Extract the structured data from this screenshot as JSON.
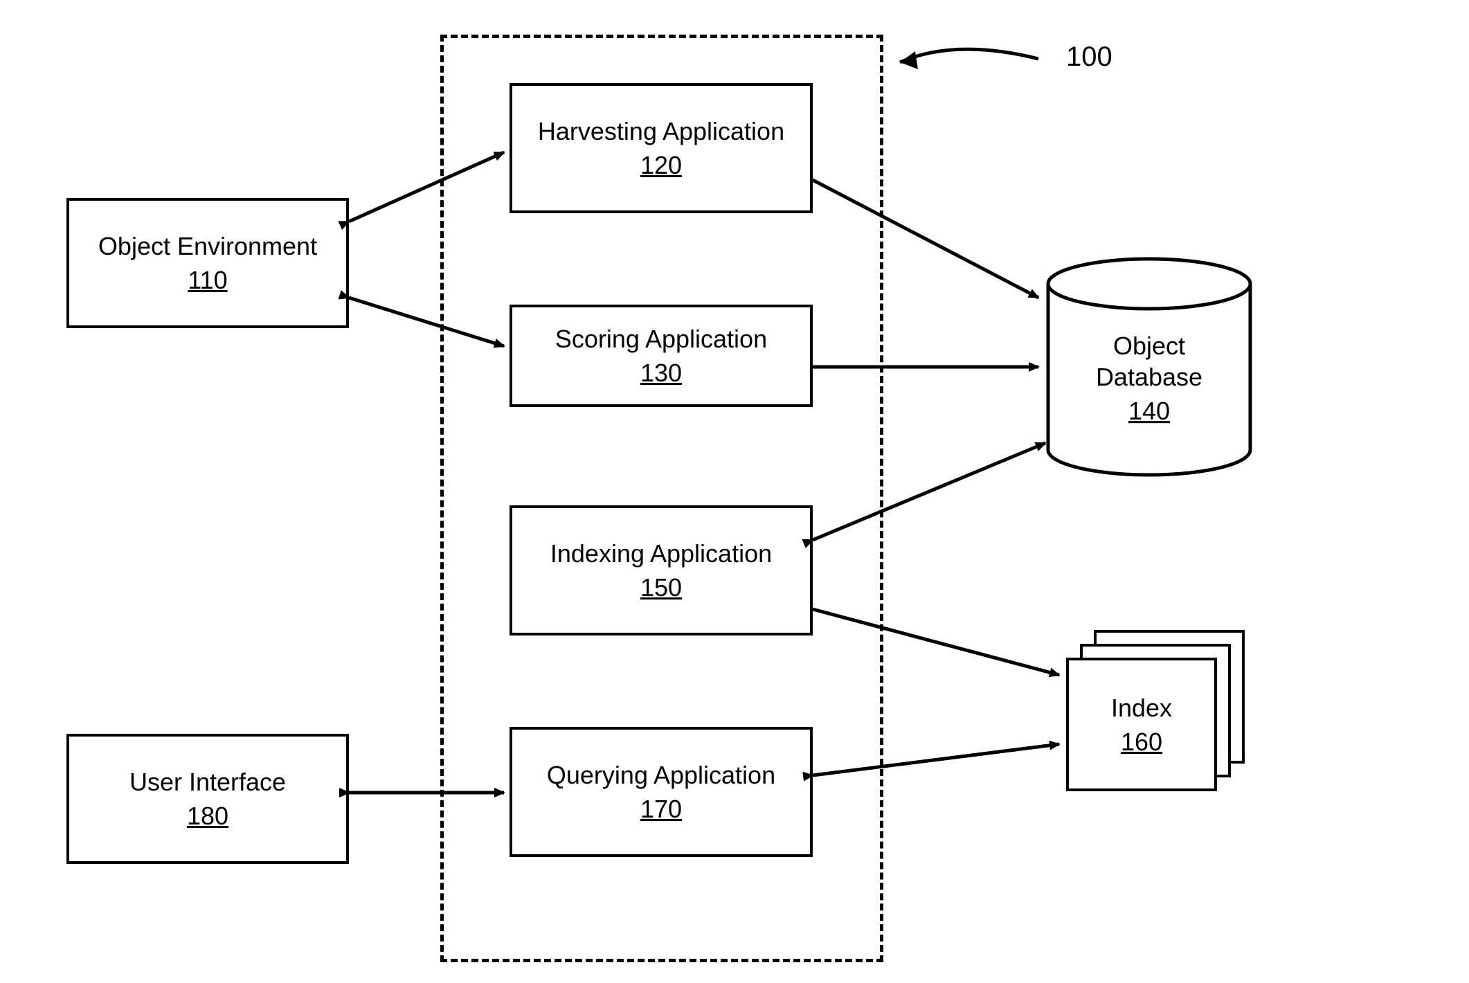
{
  "diagram": {
    "ref": "100",
    "objectEnvironment": {
      "title": "Object Environment",
      "num": "110"
    },
    "harvesting": {
      "title": "Harvesting Application",
      "num": "120"
    },
    "scoring": {
      "title": "Scoring Application",
      "num": "130"
    },
    "objectDatabase": {
      "title": "Object Database",
      "num": "140"
    },
    "indexing": {
      "title": "Indexing Application",
      "num": "150"
    },
    "index": {
      "title": "Index",
      "num": "160"
    },
    "querying": {
      "title": "Querying Application",
      "num": "170"
    },
    "userInterface": {
      "title": "User Interface",
      "num": "180"
    }
  }
}
